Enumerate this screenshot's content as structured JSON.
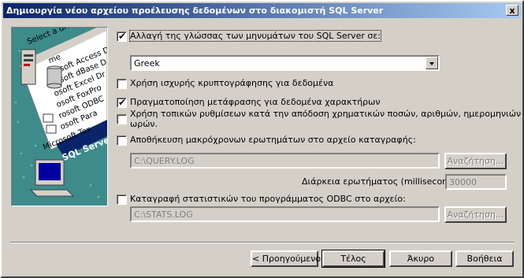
{
  "window": {
    "title": "Δημιουργία νέου αρχείου προέλευσης δεδομένων στο διακομιστή SQL Server",
    "close_glyph": "x"
  },
  "illustration": {
    "header_text": "Select a driver fo",
    "list_items": [
      "me",
      "rosoft Access D",
      "rosoft dBase D",
      "osoft Excel Dr",
      "osoft FoxPro",
      "rosoft ODBC",
      "osoft Para",
      "Microsoft Tex",
      "SQL Server"
    ],
    "colors": {
      "teal": "#3d8b8b",
      "white_panel": "#ffffff",
      "selected": "#0a246a"
    }
  },
  "options": {
    "change_language": {
      "label": "Αλλαγή της γλώσσας των μηνυμάτων του SQL Server σε:",
      "checked": true
    },
    "language_select": {
      "value": "Greek"
    },
    "strong_encryption": {
      "label": "Χρήση ισχυρής κρυπτογράφησης για δεδομένα",
      "checked": false
    },
    "char_translation": {
      "label": "Πραγματοποίηση μετάφρασης για δεδομένα χαρακτήρων",
      "checked": true
    },
    "regional_settings": {
      "label_line1": "Χρήση τοπικών ρυθμίσεων κατά την απόδοση χρηματικών ποσών, αριθμών, ημερομηνιών και",
      "label_line2": "ωρών.",
      "checked": false
    },
    "save_long_queries": {
      "label": "Αποθήκευση μακρόχρονων ερωτημάτων στο αρχείο καταγραφής:",
      "checked": false
    },
    "query_log_path": "C:\\QUERY.LOG",
    "browse_label": "Αναζήτηση...",
    "query_time_label": "Διάρκεια ερωτήματος (millisecond):",
    "query_time_value": "30000",
    "log_stats": {
      "label": "Καταγραφή στατιστικών του προγράμματος ODBC στο αρχείο:",
      "checked": false
    },
    "stats_log_path": "C:\\STATS.LOG"
  },
  "buttons": {
    "back": "< Προηγούμενο",
    "finish": "Τέλος",
    "cancel": "Άκυρο",
    "help": "Βοήθεια"
  },
  "check_glyph": "✔"
}
